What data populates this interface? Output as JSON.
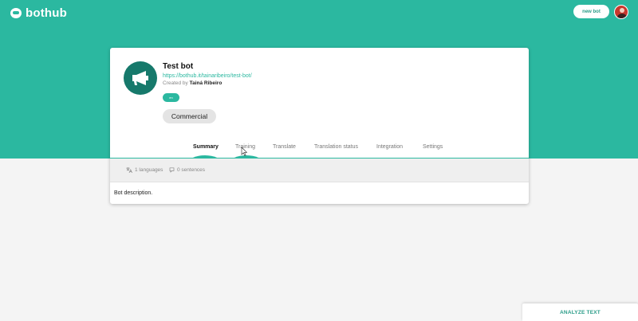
{
  "brand": {
    "name": "bothub"
  },
  "header": {
    "new_bot_label": "new bot"
  },
  "bot": {
    "name": "Test bot",
    "url": "https://bothub.it/tainaribeiro/test-bot/",
    "created_by_prefix": "Created by",
    "owner": "Tainá Ribeiro",
    "language_tag": "en",
    "category": "Commercial",
    "description": "Bot description."
  },
  "tabs": [
    {
      "label": "Summary",
      "active": true
    },
    {
      "label": "Training",
      "active": false
    },
    {
      "label": "Translate",
      "active": false
    },
    {
      "label": "Translation status",
      "active": false
    },
    {
      "label": "Integration",
      "active": false
    },
    {
      "label": "Settings",
      "active": false
    }
  ],
  "stats": {
    "languages": "1 languages",
    "sentences": "0 sentences"
  },
  "analyze": {
    "label": "ANALYZE TEXT"
  },
  "colors": {
    "primary": "#2bb8a0",
    "avatar_bg": "#16796b",
    "page_bg": "#f4f4f4"
  }
}
